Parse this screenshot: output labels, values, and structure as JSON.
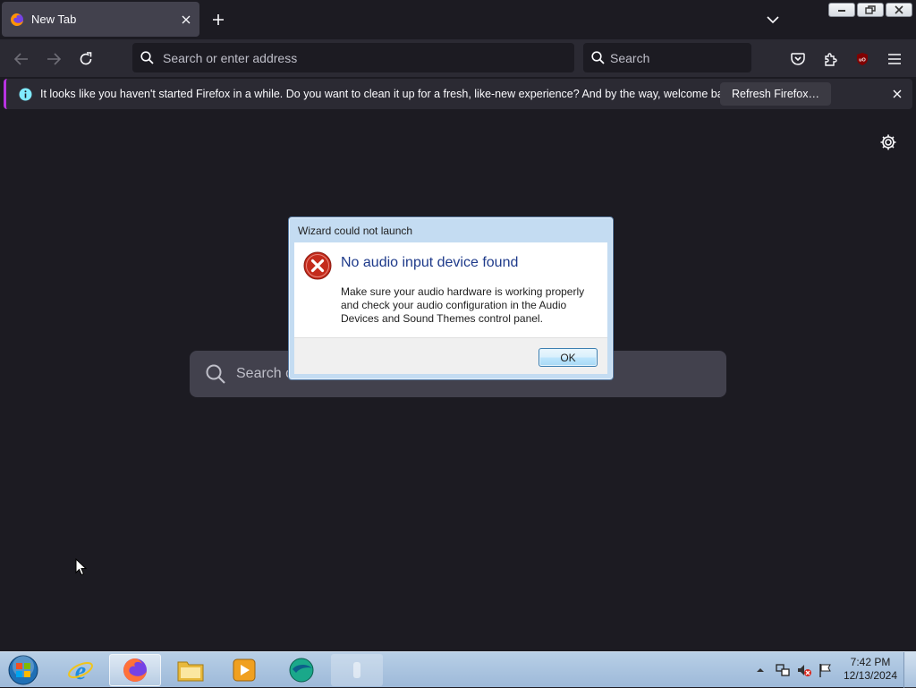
{
  "browser": {
    "tab": {
      "title": "New Tab",
      "icon": "firefox-icon"
    },
    "urlbar": {
      "placeholder": "Search or enter address"
    },
    "searchbar": {
      "placeholder": "Search"
    }
  },
  "notification": {
    "message": "It looks like you haven't started Firefox in a while. Do you want to clean it up for a fresh, like-new experience? And by the way, welcome back!",
    "button": "Refresh Firefox…",
    "accent": "#b833e1"
  },
  "newtab": {
    "search_placeholder": "Search o"
  },
  "dialog": {
    "title": "Wizard could not launch",
    "heading": "No audio input device found",
    "body": "Make sure your audio hardware is working properly and check your audio configuration in the Audio Devices and Sound Themes control panel.",
    "ok_label": "OK"
  },
  "taskbar": {
    "items": [
      "start-orb",
      "internet-explorer",
      "firefox",
      "file-explorer",
      "media-player",
      "app-globe",
      "pinned-app"
    ],
    "clock": {
      "time": "7:42 PM",
      "date": "12/13/2024"
    }
  },
  "colors": {
    "page_bg": "#1c1b22",
    "toolbar_bg": "#2b2a33",
    "field_bg": "#42414d",
    "dialog_heading": "#1e3a8a"
  }
}
